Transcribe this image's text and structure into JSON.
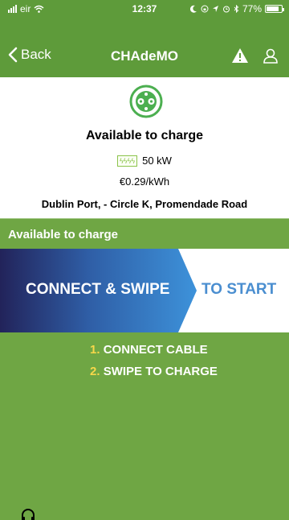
{
  "status_bar": {
    "carrier": "eir",
    "time": "12:37",
    "battery": "77%"
  },
  "nav": {
    "back_label": "Back",
    "title": "CHAdeMO"
  },
  "charger": {
    "status": "Available to charge",
    "power_badge": "ϟϟϟϟ",
    "power": "50 kW",
    "price": "€0.29/kWh",
    "address": "Dublin Port, - Circle K, Promendade Road"
  },
  "status_strip": "Available to charge",
  "banner": {
    "left": "CONNECT & SWIPE",
    "right": "TO START"
  },
  "steps": [
    {
      "num": "1.",
      "label": "CONNECT CABLE"
    },
    {
      "num": "2.",
      "label": "SWIPE TO CHARGE"
    }
  ],
  "colors": {
    "header_green": "#5e9b3a",
    "panel_green": "#6fa644",
    "step_number_yellow": "#f7d74a",
    "banner_dark": "#22235a",
    "banner_blue": "#3a86d0"
  },
  "icons": {
    "warning": "warning-icon",
    "user": "user-icon",
    "plug": "chademo-plug-icon",
    "headphones": "headphones-icon"
  }
}
